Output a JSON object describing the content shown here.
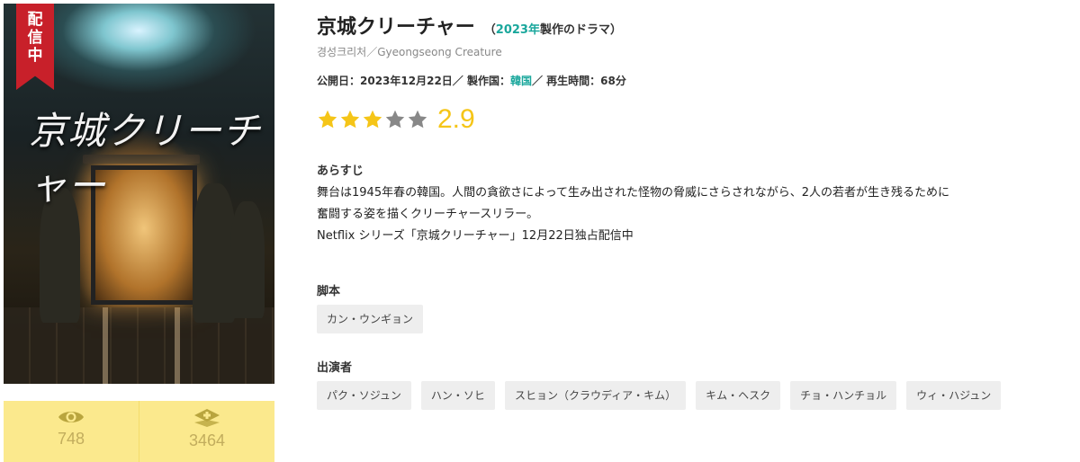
{
  "poster": {
    "ribbon": "配\n信\n中",
    "title_text": "京城クリーチャー"
  },
  "stats": {
    "views": "748",
    "adds": "3464",
    "icon_views": "eye-icon",
    "icon_adds": "plus-diamond-icon",
    "color_bg": "#fbe98d"
  },
  "title": {
    "main": "京城クリーチャー",
    "sub_open": "（",
    "year": "2023年",
    "sub_rest": "製作のドラマ）"
  },
  "original_title": "경성크리처／Gyeongseong Creature",
  "meta": {
    "prefix": "公開日：2023年12月22日／ 製作国：",
    "country": "韓国",
    "suffix": "／ 再生時間：68分"
  },
  "rating": {
    "score": "2.9",
    "value": 2.9,
    "max": 5,
    "filled_stars": 3,
    "color_filled": "#f5c518",
    "color_empty": "#888888"
  },
  "synopsis": {
    "label": "あらすじ",
    "lines": [
      "舞台は1945年春の韓国。人間の貪欲さによって生み出された怪物の脅威にさらされながら、2人の若者が生き残るために",
      "奮闘する姿を描くクリーチャースリラー。",
      "Netflix シリーズ「京城クリーチャー」12月22日独占配信中"
    ]
  },
  "writer": {
    "label": "脚本",
    "names": [
      "カン・ウンギョン"
    ]
  },
  "cast": {
    "label": "出演者",
    "names": [
      "パク・ソジュン",
      "ハン・ソヒ",
      "スヒョン（クラウディア・キム）",
      "キム・ヘスク",
      "チョ・ハンチョル",
      "ウィ・ハジュン"
    ]
  },
  "accent_color": "#1aa79c"
}
